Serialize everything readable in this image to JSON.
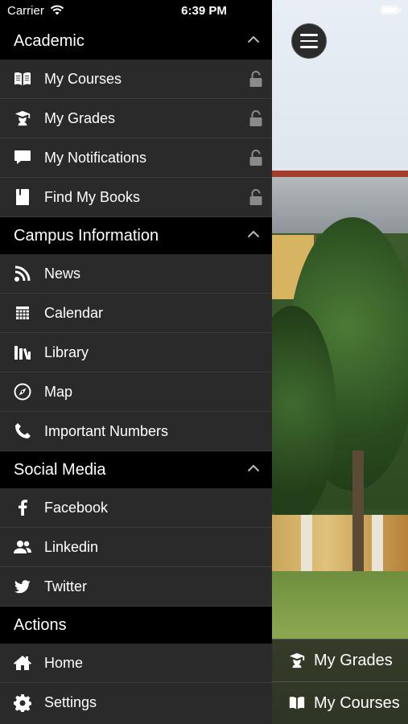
{
  "status_bar": {
    "carrier": "Carrier",
    "time": "6:39 PM"
  },
  "drawer": {
    "sections": [
      {
        "title": "Academic",
        "items": [
          {
            "label": "My Courses",
            "icon": "book-icon",
            "locked": true
          },
          {
            "label": "My Grades",
            "icon": "graduate-icon",
            "locked": true
          },
          {
            "label": "My Notifications",
            "icon": "speech-bubble-icon",
            "locked": true
          },
          {
            "label": "Find My Books",
            "icon": "bookmark-book-icon",
            "locked": true
          }
        ]
      },
      {
        "title": "Campus Information",
        "items": [
          {
            "label": "News",
            "icon": "rss-icon"
          },
          {
            "label": "Calendar",
            "icon": "calendar-icon"
          },
          {
            "label": "Library",
            "icon": "library-icon"
          },
          {
            "label": "Map",
            "icon": "compass-icon"
          },
          {
            "label": "Important Numbers",
            "icon": "phone-icon"
          }
        ]
      },
      {
        "title": "Social Media",
        "items": [
          {
            "label": "Facebook",
            "icon": "facebook-icon"
          },
          {
            "label": "Linkedin",
            "icon": "people-icon"
          },
          {
            "label": "Twitter",
            "icon": "twitter-icon"
          }
        ]
      },
      {
        "title": "Actions",
        "items": [
          {
            "label": "Home",
            "icon": "home-icon"
          },
          {
            "label": "Settings",
            "icon": "gear-icon"
          }
        ]
      }
    ]
  },
  "quick_links": [
    {
      "label": "My Grades",
      "icon": "graduate-icon"
    },
    {
      "label": "My Courses",
      "icon": "book-icon"
    }
  ],
  "colors": {
    "drawer_bg": "#2a2a2a",
    "header_bg": "#000000",
    "text": "#ffffff",
    "lock": "#8a8a8a"
  }
}
